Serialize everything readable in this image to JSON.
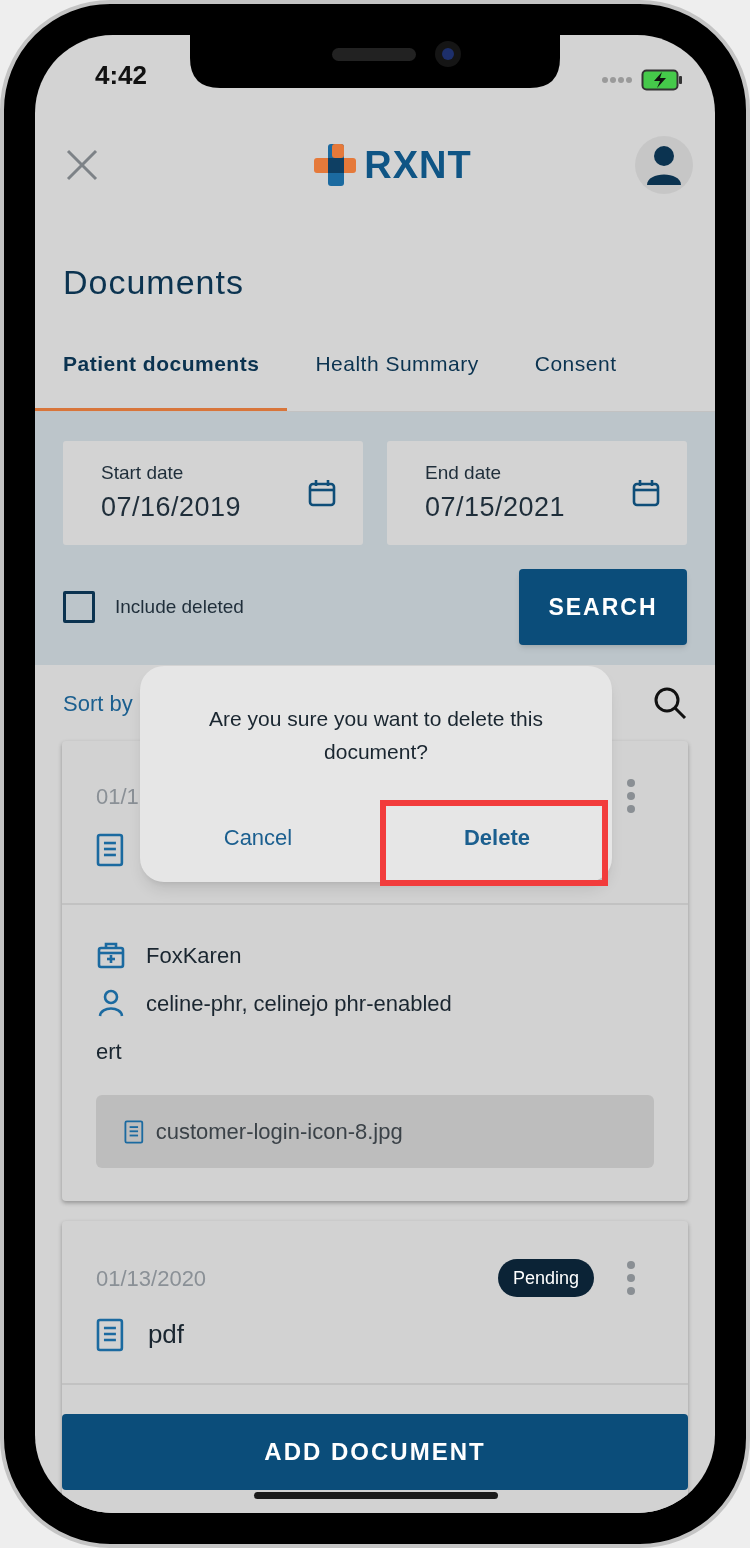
{
  "status_bar": {
    "time": "4:42"
  },
  "header": {
    "logo_text": "RXNT"
  },
  "page_title": "Documents",
  "tabs": [
    {
      "label": "Patient documents",
      "selected": true
    },
    {
      "label": "Health Summary",
      "selected": false
    },
    {
      "label": "Consent",
      "selected": false
    }
  ],
  "filters": {
    "start_date": {
      "label": "Start date",
      "value": "07/16/2019"
    },
    "end_date": {
      "label": "End date",
      "value": "07/15/2021"
    },
    "include_deleted": {
      "label": "Include deleted",
      "checked": false
    },
    "search_button": "SEARCH"
  },
  "sort_label": "Sort by",
  "documents": [
    {
      "date": "01/1",
      "details": [
        {
          "kind": "provider",
          "text": "FoxKaren"
        },
        {
          "kind": "patient",
          "text": "celine-phr, celinejo phr-enabled"
        },
        {
          "kind": "note",
          "text": "ert"
        }
      ],
      "attachment": "customer-login-icon-8.jpg"
    },
    {
      "date": "01/13/2020",
      "status": "Pending",
      "title": "pdf"
    }
  ],
  "add_button": "ADD DOCUMENT",
  "dialog": {
    "message": "Are you sure you want to delete this document?",
    "buttons": [
      {
        "label": "Cancel",
        "highlighted": false
      },
      {
        "label": "Delete",
        "highlighted": true
      }
    ]
  }
}
